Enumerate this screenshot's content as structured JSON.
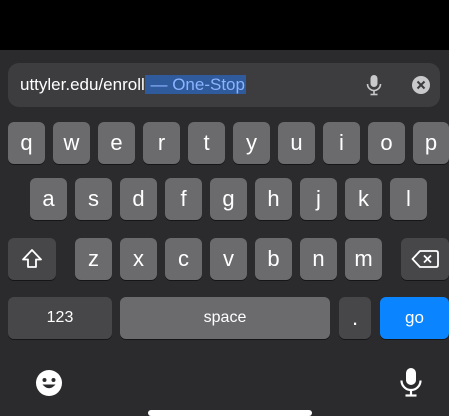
{
  "address_bar": {
    "typed_text": "uttyler.edu/enroll",
    "autocomplete_suggestion": " — One-Stop"
  },
  "keyboard": {
    "row1": [
      "q",
      "w",
      "e",
      "r",
      "t",
      "y",
      "u",
      "i",
      "o",
      "p"
    ],
    "row2": [
      "a",
      "s",
      "d",
      "f",
      "g",
      "h",
      "j",
      "k",
      "l"
    ],
    "row3": [
      "z",
      "x",
      "c",
      "v",
      "b",
      "n",
      "m"
    ],
    "numbers_key": "123",
    "space_key": "space",
    "period_key": ".",
    "go_key": "go"
  },
  "colors": {
    "go_key": "#0a84ff",
    "suggestion_highlight": "#2f5a9c"
  },
  "icons": {
    "dictation_small": "microphone-icon",
    "clear": "clear-x-icon",
    "shift": "shift-arrow-icon",
    "delete": "backspace-icon",
    "emoji": "emoji-icon",
    "dictation": "microphone-icon"
  }
}
